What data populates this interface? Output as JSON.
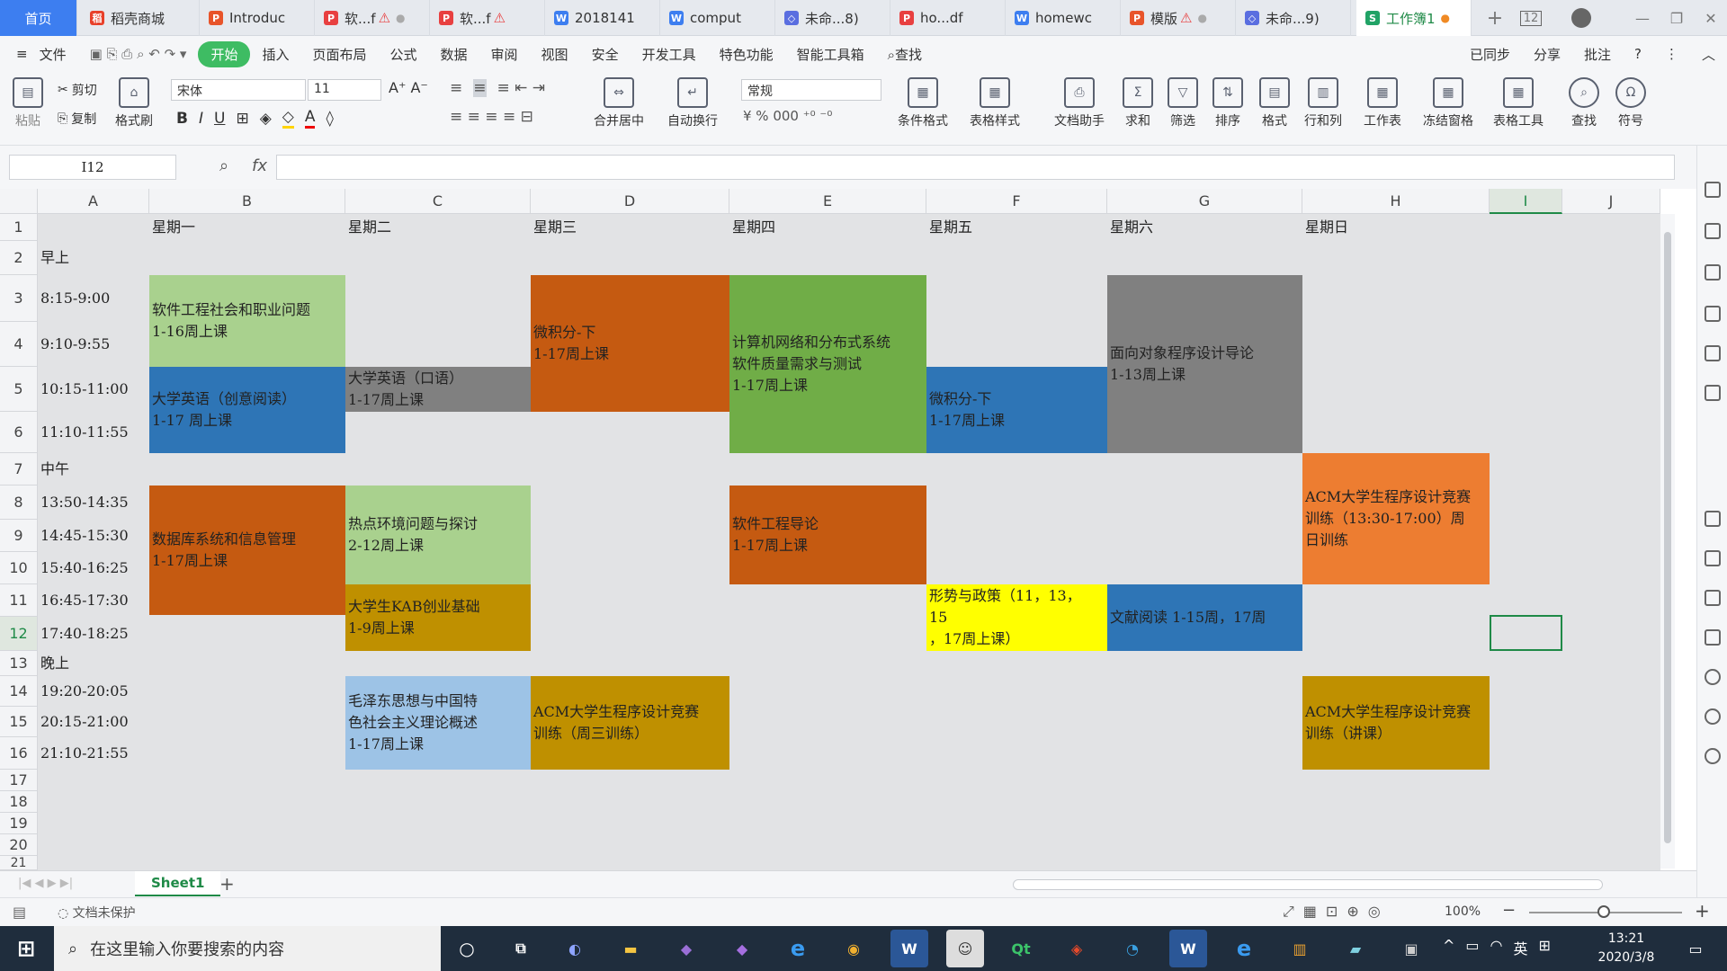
{
  "tabs": [
    {
      "label": "首页",
      "icon": "home-tab",
      "color": "#3d7ef0"
    },
    {
      "label": "稻壳商城",
      "icon": "docer-icon",
      "color": "#e8402a"
    },
    {
      "label": "Introduc",
      "icon": "ppt-icon",
      "color": "#e8542a"
    },
    {
      "label": "软...f",
      "icon": "pdf-icon",
      "color": "#e84040",
      "warn": true
    },
    {
      "label": "软...f",
      "icon": "pdf-icon",
      "color": "#e84040",
      "warn": true
    },
    {
      "label": "2018141",
      "icon": "word-icon",
      "color": "#3d7ef0"
    },
    {
      "label": "comput",
      "icon": "word-icon",
      "color": "#3d7ef0"
    },
    {
      "label": "未命...8)",
      "icon": "draw-icon",
      "color": "#5a6ee0"
    },
    {
      "label": "ho...df",
      "icon": "pdf-icon",
      "color": "#e84040"
    },
    {
      "label": "homewc",
      "icon": "word-icon",
      "color": "#3d7ef0"
    },
    {
      "label": "模版",
      "icon": "ppt-icon",
      "color": "#e8542a",
      "warn": true
    },
    {
      "label": "未命...9)",
      "icon": "draw-icon",
      "color": "#5a6ee0"
    },
    {
      "label": "工作簿1",
      "icon": "sheet-icon",
      "color": "#21a366"
    }
  ],
  "tab_count_badge": "12",
  "menu": [
    "文件",
    "开始",
    "插入",
    "页面布局",
    "公式",
    "数据",
    "审阅",
    "视图",
    "安全",
    "开发工具",
    "特色功能",
    "智能工具箱",
    "查找"
  ],
  "menu_right": [
    "已同步",
    "分享",
    "批注"
  ],
  "ribbon": {
    "paste": "粘贴",
    "cut": "剪切",
    "copy": "复制",
    "format_painter": "格式刷",
    "font": "宋体",
    "size": "11",
    "merge": "合并居中",
    "wrap": "自动换行",
    "number_format": "常规",
    "cond_format": "条件格式",
    "table_style": "表格样式",
    "doc_helper": "文档助手",
    "sum": "求和",
    "filter": "筛选",
    "sort": "排序",
    "format": "格式",
    "row_col": "行和列",
    "worksheet": "工作表",
    "freeze": "冻结窗格",
    "table_tools": "表格工具",
    "find": "查找",
    "symbol": "符号"
  },
  "name_box": "I12",
  "fx": "fx",
  "columns": [
    "A",
    "B",
    "C",
    "D",
    "E",
    "F",
    "G",
    "H",
    "I",
    "J"
  ],
  "rows": [
    "1",
    "2",
    "3",
    "4",
    "5",
    "6",
    "7",
    "8",
    "9",
    "10",
    "11",
    "12",
    "13",
    "14",
    "15",
    "16",
    "17",
    "18",
    "19",
    "20",
    "21"
  ],
  "days": [
    "星期一",
    "星期二",
    "星期三",
    "星期四",
    "星期五",
    "星期六",
    "星期日"
  ],
  "times": {
    "r2": "早上",
    "r3": "8:15-9:00",
    "r4": "9:10-9:55",
    "r5": "10:15-11:00",
    "r6": "11:10-11:55",
    "r7": "中午",
    "r8": "13:50-14:35",
    "r9": "14:45-15:30",
    "r10": "15:40-16:25",
    "r11": "16:45-17:30",
    "r12": "17:40-18:25",
    "r13": "晚上",
    "r14": "19:20-20:05",
    "r15": "20:15-21:00",
    "r16": "21:10-21:55"
  },
  "courses": [
    {
      "text": "软件工程社会和职业问题\n1-16周上课",
      "color": "#a9d18e"
    },
    {
      "text": "大学英语（创意阅读）\n1-17 周上课",
      "color": "#2e75b6"
    },
    {
      "text": "大学英语（口语）\n1-17周上课",
      "color": "#808080"
    },
    {
      "text": "微积分-下\n1-17周上课",
      "color": "#c55a11"
    },
    {
      "text": "计算机网络和分布式系统\n软件质量需求与测试\n1-17周上课",
      "color": "#70ad47"
    },
    {
      "text": "微积分-下\n1-17周上课",
      "color": "#2e75b6"
    },
    {
      "text": "面向对象程序设计导论\n1-13周上课",
      "color": "#808080"
    },
    {
      "text": "数据库系统和信息管理\n1-17周上课",
      "color": "#c55a11"
    },
    {
      "text": "热点环境问题与探讨\n2-12周上课",
      "color": "#a9d18e"
    },
    {
      "text": "软件工程导论\n1-17周上课",
      "color": "#c55a11"
    },
    {
      "text": "ACM大学生程序设计竞赛\n训练（13:30-17:00）周\n日训练",
      "color": "#ed7d31"
    },
    {
      "text": "大学生KAB创业基础\n1-9周上课",
      "color": "#bf9000"
    },
    {
      "text": "形势与政策（11，13，\n15\n，17周上课）",
      "color": "#ffff00"
    },
    {
      "text": "文献阅读 1-15周，17周",
      "color": "#2e75b6"
    },
    {
      "text": "毛泽东思想与中国特\n色社会主义理论概述\n1-17周上课",
      "color": "#9dc3e6"
    },
    {
      "text": "ACM大学生程序设计竞赛\n训练（周三训练）",
      "color": "#bf9000"
    },
    {
      "text": "ACM大学生程序设计竞赛\n训练（讲课）",
      "color": "#bf9000"
    }
  ],
  "sheet_tab": "Sheet1",
  "status": {
    "protect": "文档未保护",
    "zoom": "100%"
  },
  "taskbar": {
    "search": "在这里输入你要搜索的内容",
    "time": "13:21",
    "date": "2020/3/8",
    "ime": "英"
  }
}
